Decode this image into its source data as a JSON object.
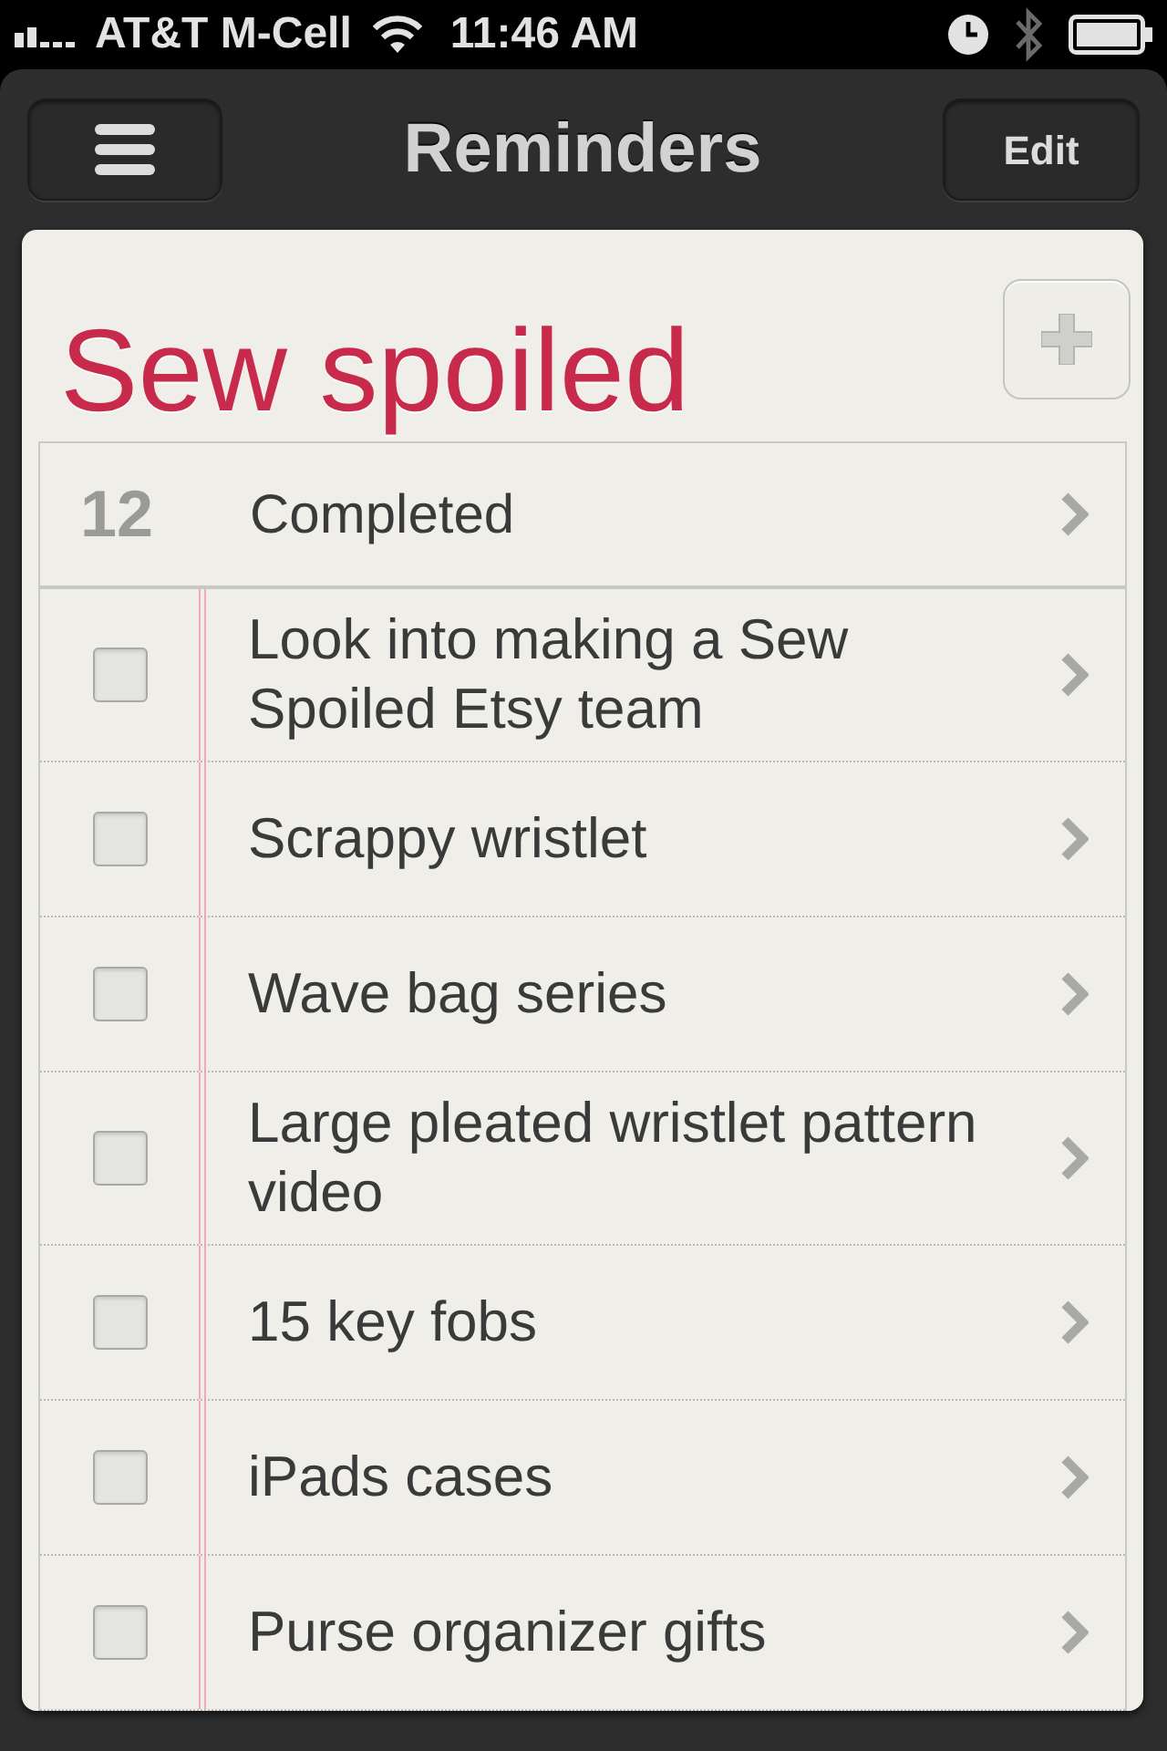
{
  "status_bar": {
    "carrier": "AT&T M-Cell",
    "time": "11:46 AM"
  },
  "nav_bar": {
    "title": "Reminders",
    "edit_button": "Edit"
  },
  "list": {
    "title": "Sew spoiled",
    "completed": {
      "count": "12",
      "label": "Completed"
    },
    "items": [
      {
        "text": "Look into making a Sew Spoiled Etsy team",
        "checked": false
      },
      {
        "text": "Scrappy wristlet",
        "checked": false
      },
      {
        "text": "Wave bag series",
        "checked": false
      },
      {
        "text": "Large pleated wristlet pattern video",
        "checked": false
      },
      {
        "text": "15 key fobs",
        "checked": false
      },
      {
        "text": "iPads cases",
        "checked": false
      },
      {
        "text": "Purse organizer gifts",
        "checked": false
      }
    ]
  }
}
